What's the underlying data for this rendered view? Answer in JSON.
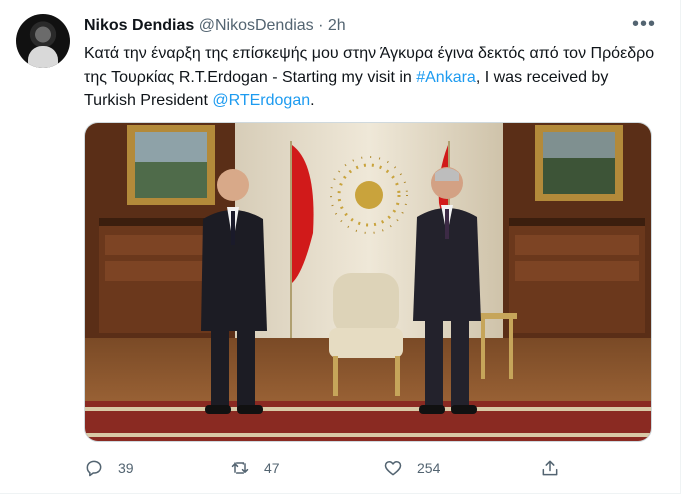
{
  "tweet": {
    "author_name": "Nikos Dendias",
    "author_handle": "@NikosDendias",
    "separator": "·",
    "time": "2h",
    "text_part1": "Κατά την έναρξη της επίσκεψής μου στην Άγκυρα έγινα δεκτός από τον Πρόεδρο της Τουρκίας R.T.Erdogan - Starting my visit in ",
    "hashtag": "#Ankara",
    "text_part2": ", I was received by Turkish President ",
    "mention": "@RTErdogan",
    "text_part3": ".",
    "more_glyph": "•••"
  },
  "actions": {
    "reply_count": "39",
    "retweet_count": "47",
    "like_count": "254"
  },
  "icons": {
    "reply": "reply-icon",
    "retweet": "retweet-icon",
    "like": "heart-icon",
    "share": "share-icon",
    "more": "more-icon"
  },
  "colors": {
    "link": "#1d9bf0",
    "muted": "#536471"
  }
}
